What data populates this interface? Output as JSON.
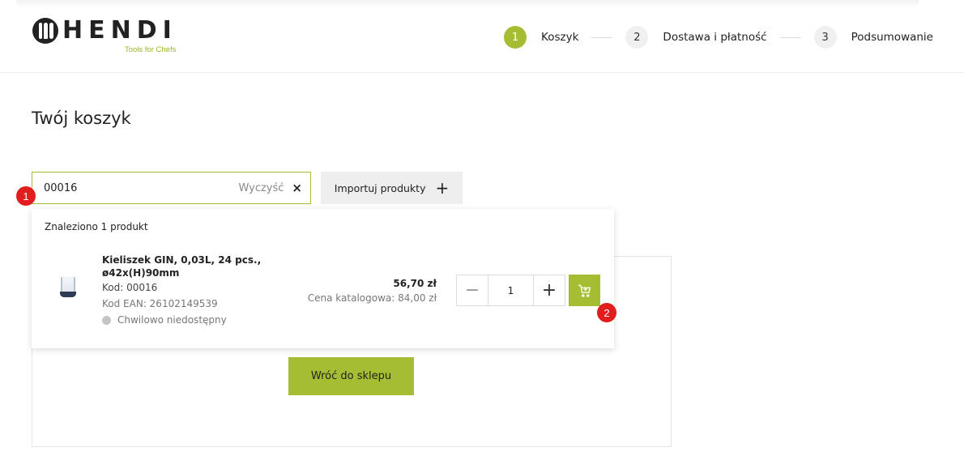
{
  "header": {
    "logo_text": "HENDI",
    "logo_tagline": "Tools for Chefs",
    "steps": [
      {
        "number": "1",
        "label": "Koszyk",
        "active": true
      },
      {
        "number": "2",
        "label": "Dostawa i płatność",
        "active": false
      },
      {
        "number": "3",
        "label": "Podsumowanie",
        "active": false
      }
    ]
  },
  "page": {
    "title": "Twój koszyk"
  },
  "search": {
    "value": "00016",
    "clear_label": "Wyczyść",
    "clear_icon": "×"
  },
  "import_button": {
    "label": "Importuj produkty",
    "icon": "+"
  },
  "annotations": {
    "badge_1": "1",
    "badge_2": "2"
  },
  "results": {
    "count_text": "Znaleziono 1 produkt",
    "product": {
      "name": "Kieliszek GIN, 0,03L, 24 pcs., ø42x(H)90mm",
      "code": "Kod: 00016",
      "ean": "Kod EAN: 26102149539",
      "availability": "Chwilowo niedostępny",
      "price": "56,70 zł",
      "catalog_price": "Cena katalogowa: 84,00 zł",
      "quantity": "1",
      "minus_icon": "−",
      "plus_icon": "+"
    }
  },
  "cart": {
    "back_button": "Wróć do sklepu"
  },
  "colors": {
    "accent": "#a5bd32",
    "badge": "#e21d1d"
  }
}
